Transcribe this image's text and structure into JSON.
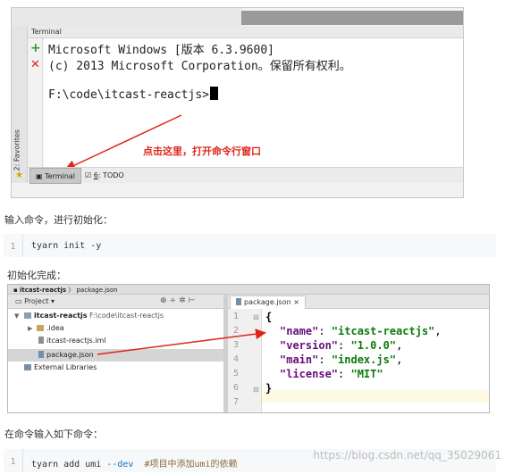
{
  "terminal_window": {
    "panel_title": "Terminal",
    "favorites_label": "2: Favorites",
    "lines": [
      "Microsoft Windows [版本 6.3.9600]",
      "(c) 2013 Microsoft Corporation。保留所有权利。",
      "F:\\code\\itcast-reactjs>"
    ],
    "annotation": "点击这里，打开命令行窗口",
    "bottom_tabs": [
      {
        "label": "Terminal",
        "icon": "terminal-icon",
        "active": true
      },
      {
        "num": "6",
        "label": ": TODO",
        "icon": "todo-icon",
        "active": false
      }
    ]
  },
  "para1": "输入命令，进行初始化：",
  "code1": {
    "line": "1",
    "code": "tyarn init -y"
  },
  "para2": "初始化完成：",
  "project_window": {
    "nav": {
      "project": "itcast-reactjs",
      "file": "package.json"
    },
    "panel_title": "Project",
    "tree": {
      "root_name": "itcast-reactjs",
      "root_path": "F:\\code\\itcast-reactjs",
      "idea": ".idea",
      "iml": "itcast-reactjs.iml",
      "pkg": "package.json",
      "libs": "External Libraries"
    },
    "editor_tab": "package.json",
    "line_numbers": [
      "1",
      "2",
      "3",
      "4",
      "5",
      "6",
      "7"
    ],
    "json": {
      "open": "{",
      "close": "}",
      "entries": [
        {
          "key": "\"name\"",
          "value": "\"itcast-reactjs\"",
          "sep": ","
        },
        {
          "key": "\"version\"",
          "value": "\"1.0.0\"",
          "sep": ","
        },
        {
          "key": "\"main\"",
          "value": "\"index.js\"",
          "sep": ","
        },
        {
          "key": "\"license\"",
          "value": "\"MIT\"",
          "sep": ""
        }
      ]
    }
  },
  "para3": "在命令输入如下命令：",
  "code2": {
    "line": "1",
    "cmd": "tyarn add umi ",
    "flag": "--dev",
    "comment": "#项目中添加umi的依赖"
  },
  "watermark": "https://blog.csdn.net/qq_35029061",
  "colors": {
    "annotation": "#e0241b",
    "json_key": "#660e7a",
    "json_value": "#0b7a0b"
  }
}
